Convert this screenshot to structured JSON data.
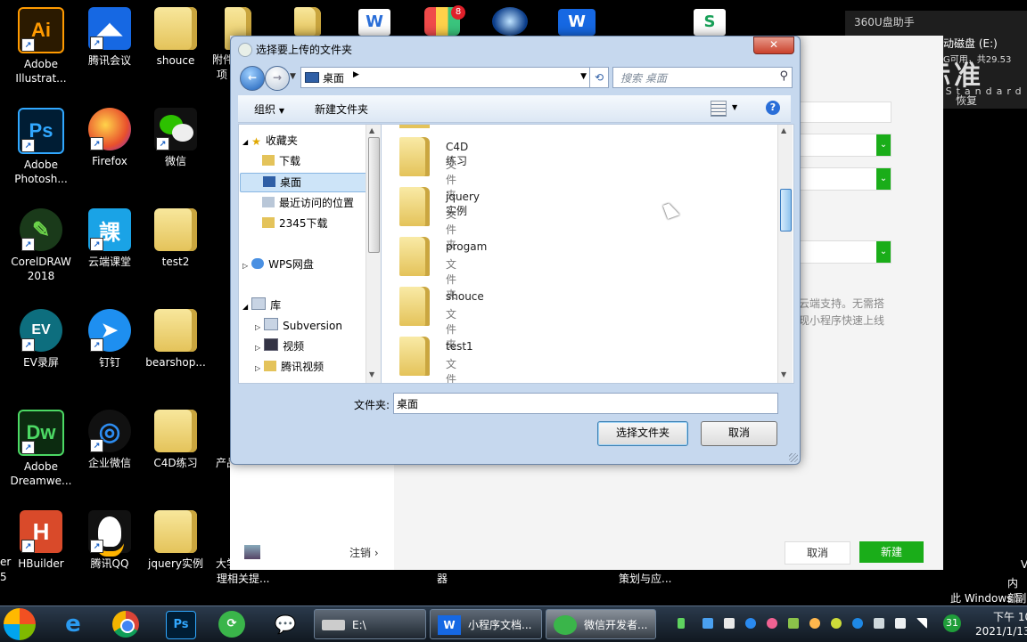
{
  "desktop": {
    "icons": [
      {
        "label": "Adobe Illustrat...",
        "glyph": "Ai",
        "color": "#2b1a00",
        "fg": "#ff9a00"
      },
      {
        "label": "Adobe Photosh...",
        "glyph": "Ps",
        "color": "#001d34",
        "fg": "#31a8ff"
      },
      {
        "label": "CorelDRAW 2018",
        "glyph": "✎",
        "color": "#1a3a1a",
        "fg": "#6bd34a"
      },
      {
        "label": "EV录屏",
        "glyph": "EV",
        "color": "#0d6e7e",
        "fg": "#ffffff"
      },
      {
        "label": "Adobe Dreamwe...",
        "glyph": "Dw",
        "color": "#0c2b10",
        "fg": "#4cd964"
      },
      {
        "label": "HBuilder",
        "glyph": "H",
        "color": "#d94a2a",
        "fg": "#ffffff"
      },
      {
        "label": "腾讯会议",
        "glyph": "◢◣",
        "color": "#1668e3",
        "fg": "#ffffff"
      },
      {
        "label": "Firefox",
        "glyph": "●",
        "color": "#e8502c",
        "fg": "#ffd34a"
      },
      {
        "label": "云端课堂",
        "glyph": "课",
        "color": "#1aa3e6",
        "fg": "#ffffff"
      },
      {
        "label": "钉钉",
        "glyph": "➤",
        "color": "#1e8ff0",
        "fg": "#ffffff"
      },
      {
        "label": "企业微信",
        "glyph": "◎",
        "color": "#1d1d1d",
        "fg": "#2d8cf0"
      },
      {
        "label": "腾讯QQ",
        "glyph": "Q",
        "color": "#111111",
        "fg": "#ffffff"
      },
      {
        "label": "shouce",
        "glyph": "",
        "color": "folder",
        "fg": ""
      },
      {
        "label": "微信",
        "glyph": "💬",
        "color": "#2dc100",
        "fg": "#ffffff"
      },
      {
        "label": "test2",
        "glyph": "",
        "color": "folder",
        "fg": ""
      },
      {
        "label": "bearshop...",
        "glyph": "",
        "color": "folder",
        "fg": ""
      },
      {
        "label": "C4D练习",
        "glyph": "",
        "color": "folder",
        "fg": ""
      },
      {
        "label": "jquery实例",
        "glyph": "",
        "color": "folder",
        "fg": ""
      },
      {
        "label": "附件",
        "glyph": "",
        "color": "folder",
        "fg": ""
      },
      {
        "label": "项",
        "glyph": "",
        "color": "",
        "fg": ""
      },
      {
        "label": "产品",
        "glyph": "",
        "color": "",
        "fg": ""
      },
      {
        "label": "大学",
        "glyph": "",
        "color": "",
        "fg": ""
      },
      {
        "label": "理相关提...",
        "glyph": "",
        "color": "",
        "fg": ""
      },
      {
        "label": "器",
        "glyph": "",
        "color": "",
        "fg": ""
      },
      {
        "label": "策划与应...",
        "glyph": "",
        "color": "",
        "fg": ""
      }
    ],
    "edge_left": [
      "er",
      "5"
    ],
    "right_text": [
      "V",
      "内部",
      "此 Windows 副"
    ]
  },
  "widget360": {
    "title": "360U盘助手",
    "disk": "动磁盘 (E:)",
    "avail": "G可用，共29.53",
    "recover": "恢复",
    "logo": "东方标准",
    "logo_sub": "Oriental Standard"
  },
  "bgapp": {
    "cloud_line1": "云端支持。无需搭",
    "cloud_line2": "现小程序快速上线",
    "logout": "注销",
    "cancel": "取消",
    "create": "新建"
  },
  "dialog": {
    "title": "选择要上传的文件夹",
    "close": "✕",
    "address": "桌面",
    "search_placeholder": "搜索 桌面",
    "organize": "组织",
    "new_folder": "新建文件夹",
    "help": "?",
    "nav": [
      {
        "label": "收藏夹",
        "indent": 0,
        "icon": "star"
      },
      {
        "label": "下载",
        "indent": 1,
        "icon": "folder"
      },
      {
        "label": "桌面",
        "indent": 1,
        "icon": "desk"
      },
      {
        "label": "最近访问的位置",
        "indent": 1,
        "icon": "recent"
      },
      {
        "label": "2345下载",
        "indent": 1,
        "icon": "folder"
      },
      {
        "label": "WPS网盘",
        "indent": 0,
        "icon": "cloud"
      },
      {
        "label": "库",
        "indent": 0,
        "icon": "lib"
      },
      {
        "label": "Subversion",
        "indent": 1,
        "icon": "lib"
      },
      {
        "label": "视频",
        "indent": 1,
        "icon": "video"
      },
      {
        "label": "腾讯视频",
        "indent": 1,
        "icon": "folder"
      }
    ],
    "files": [
      {
        "name": "C4D练习",
        "type": "文件夹"
      },
      {
        "name": "jquery实例",
        "type": "文件夹"
      },
      {
        "name": "progam",
        "type": "文件夹"
      },
      {
        "name": "shouce",
        "type": "文件夹"
      },
      {
        "name": "test1",
        "type": "文件夹"
      }
    ],
    "folder_label": "文件夹:",
    "folder_value": "桌面",
    "select_btn": "选择文件夹",
    "cancel_btn": "取消"
  },
  "taskbar": {
    "tasks": [
      {
        "label": "E:\\"
      },
      {
        "label": "小程序文档..."
      },
      {
        "label": "微信开发者..."
      }
    ],
    "clock_line1": "下午 10",
    "clock_line2": "2021/1/13",
    "badge": "31"
  }
}
